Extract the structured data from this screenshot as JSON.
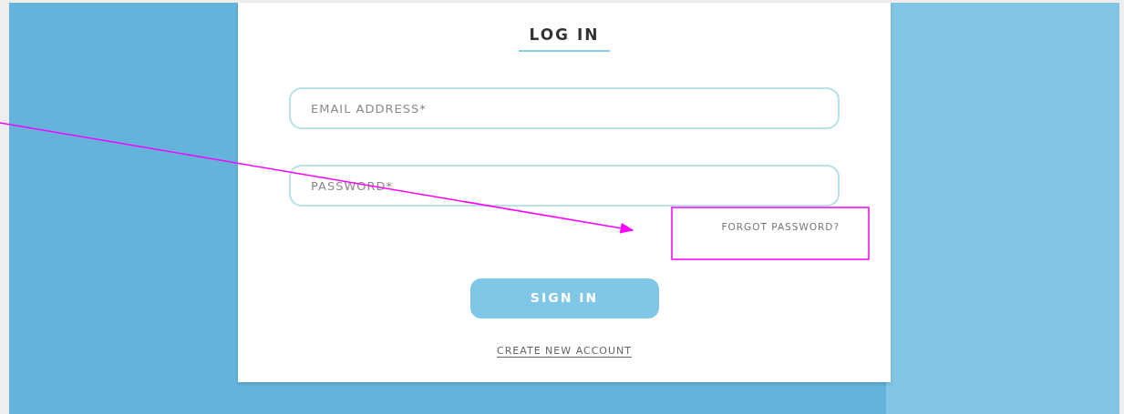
{
  "login_card": {
    "title": "LOG IN",
    "fields": [
      {
        "placeholder": "EMAIL ADDRESS*"
      },
      {
        "placeholder": "PASSWORD*"
      }
    ],
    "forgot_link": "FORGOT PASSWORD?",
    "submit_button": "SIGN IN",
    "create_account_link": "CREATE NEW ACCOUNT"
  }
}
